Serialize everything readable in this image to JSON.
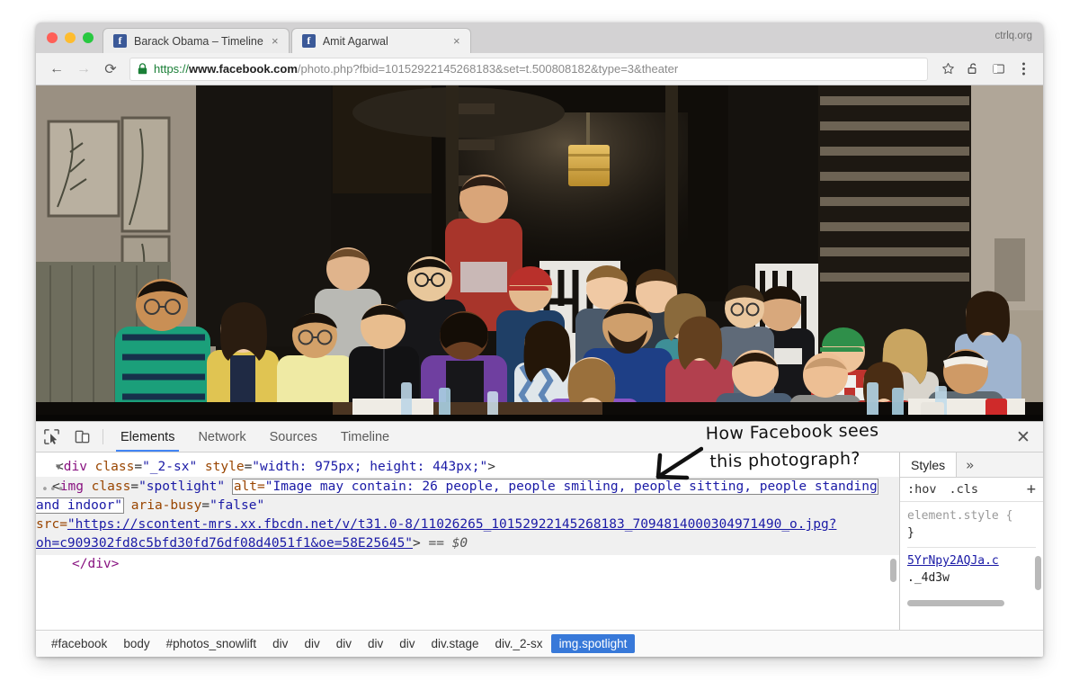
{
  "watermark": "ctrlq.org",
  "browser": {
    "tabs": [
      {
        "title": "Barack Obama – Timeline",
        "favicon": "facebook-favicon",
        "active": false,
        "close_label": "×"
      },
      {
        "title": "Amit Agarwal",
        "favicon": "facebook-favicon",
        "active": true,
        "close_label": "×"
      }
    ],
    "nav": {
      "back": "←",
      "forward": "→",
      "reload": "⟳"
    },
    "omnibox": {
      "lock": "secure-lock-icon",
      "scheme": "https://",
      "host": "www.facebook.com",
      "path": "/photo.php?fbid=10152922145268183&set=t.500808182&type=3&theater",
      "full_url": "https://www.facebook.com/photo.php?fbid=10152922145268183&set=t.500808182&type=3&theater"
    },
    "toolbar_icons": [
      "bookmark-star-icon",
      "unlock-icon",
      "cast-window-icon",
      "overflow-menu-icon"
    ]
  },
  "annotation": {
    "line1": "How Facebook sees",
    "line2": "this photograph?"
  },
  "devtools": {
    "tools": [
      "inspect-element-icon",
      "device-toolbar-icon"
    ],
    "tabs": [
      {
        "label": "Elements",
        "active": true
      },
      {
        "label": "Network",
        "active": false
      },
      {
        "label": "Sources",
        "active": false
      },
      {
        "label": "Timeline",
        "active": false
      }
    ],
    "close_label": "✕",
    "tree": {
      "line1": {
        "triangle": "▼",
        "open": "<",
        "tag": "div",
        "attr1_name": "class",
        "attr1_value": "\"_2-sx\"",
        "attr2_name": "style",
        "attr2_value": "\"width: 975px; height: 443px;\"",
        "close": ">"
      },
      "img": {
        "open": "<",
        "tag": "img",
        "class_name": "class",
        "class_value": "\"spotlight\"",
        "alt_name": "alt=",
        "alt_value": "\"Image may contain: 26 people, people smiling, people sitting, people standing and indoor\"",
        "aria_name": "aria-busy",
        "aria_value": "\"false\"",
        "src_name": "src=",
        "src_value": "\"https://scontent-mrs.xx.fbcdn.net/v/t31.0-8/11026265_10152922145268183_7094814000304971490_o.jpg?oh=c909302fd8c5bfd30fd76df08d4051f1&oe=58E25645\"",
        "close": ">",
        "selection_marker": "== $0"
      },
      "line_close": "</div>"
    },
    "breadcrumb": [
      {
        "label": "#facebook",
        "selected": false
      },
      {
        "label": "body",
        "selected": false
      },
      {
        "label": "#photos_snowlift",
        "selected": false
      },
      {
        "label": "div",
        "selected": false
      },
      {
        "label": "div",
        "selected": false
      },
      {
        "label": "div",
        "selected": false
      },
      {
        "label": "div",
        "selected": false
      },
      {
        "label": "div",
        "selected": false
      },
      {
        "label": "div.stage",
        "selected": false
      },
      {
        "label": "div._2-sx",
        "selected": false
      },
      {
        "label": "img.spotlight",
        "selected": true
      }
    ],
    "styles": {
      "tab_label": "Styles",
      "more_label": "»",
      "hov_label": ":hov",
      "cls_label": ".cls",
      "plus_label": "+",
      "rule1_selector": "element.style {",
      "rule1_close": "}",
      "rule2_source": "5YrNpy2AQJa.c",
      "rule2_selector": "._4d3w"
    }
  },
  "colors": {
    "accent_blue": "#4285f4",
    "selection_blue": "#3879d9",
    "highlight_blue": "#cfe0f7",
    "tag_purple": "#881280",
    "attr_orange": "#994500",
    "value_blue": "#1a1aa6",
    "secure_green": "#1a7f37"
  }
}
